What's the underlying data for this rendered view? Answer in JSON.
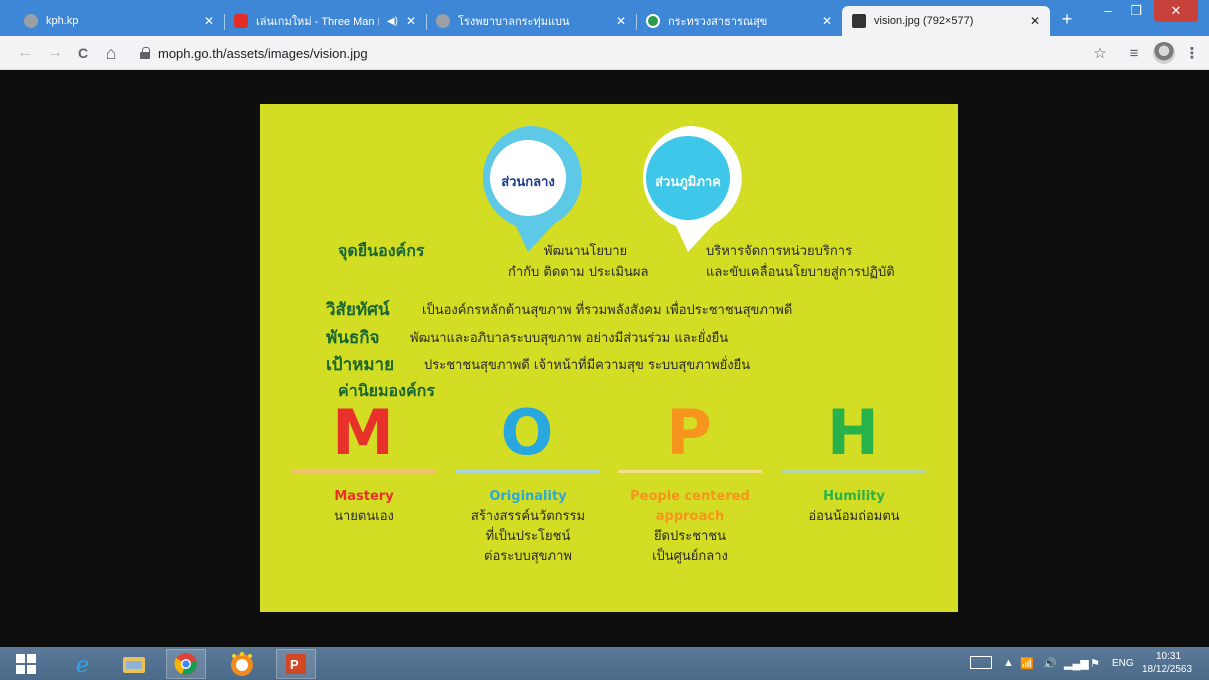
{
  "browser": {
    "tabs": [
      {
        "title": "kph.kp",
        "favicon_color": "#9aa0a6",
        "active": false
      },
      {
        "title": "เล่นเกมใหม่ - Three Man Down",
        "favicon_color": "#e52d27",
        "active": false,
        "audio_icon": "speaker-icon"
      },
      {
        "title": "โรงพยาบาลกระทุ่มแบน",
        "favicon_color": "#9aa0a6",
        "active": false
      },
      {
        "title": "กระทรวงสาธารณสุข",
        "favicon_color": "#2e9a4c",
        "active": false
      },
      {
        "title": "vision.jpg (792×577)",
        "favicon_color": "#333333",
        "active": true
      }
    ],
    "new_tab": "+",
    "window_controls": {
      "minimize": "–",
      "maximize": "❐",
      "close": "✕"
    },
    "url": "moph.go.th/assets/images/vision.jpg",
    "nav": {
      "back": "←",
      "forward": "→",
      "reload": "C",
      "home": "⌂"
    },
    "toolbar_icons": {
      "star": "☆",
      "playlist": "≡",
      "menu": "⋮"
    }
  },
  "slide": {
    "pins": [
      {
        "label": "ส่วนกลาง",
        "ring": "#5ec9e6",
        "fill": "#ffffff",
        "text_color": "#1a3a8a"
      },
      {
        "label": "ส่วนภูมิภาค",
        "ring": "#ffffff",
        "fill": "#3ec7e8",
        "text_color": "#ffffff"
      }
    ],
    "stance_heading": "จุดยืนองค์กร",
    "stance_central": [
      "พัฒนานโยบาย",
      "กำกับ ติดตาม ประเมินผล"
    ],
    "stance_regional": [
      "บริหารจัดการหน่วยบริการ",
      "และขับเคลื่อนนโยบายสู่การปฏิบัติ"
    ],
    "vision_heading": "วิสัยทัศน์",
    "vision_text": "เป็นองค์กรหลักด้านสุขภาพ ที่รวมพลังสังคม เพื่อประชาชนสุขภาพดี",
    "mission_heading": "พันธกิจ",
    "mission_text": "พัฒนาและอภิบาลระบบสุขภาพ อย่างมีส่วนร่วม และยั่งยืน",
    "goal_heading": "เป้าหมาย",
    "goal_text": "ประชาชนสุขภาพดี เจ้าหน้าที่มีความสุข ระบบสุขภาพยั่งยืน",
    "values_heading": "ค่านิยมองค์กร",
    "values": [
      {
        "letter": "M",
        "color": "#e8312a",
        "line": "#f5c07a",
        "name": [
          "Mastery"
        ],
        "desc": [
          "นายตนเอง"
        ]
      },
      {
        "letter": "O",
        "color": "#29a8e0",
        "line": "#a8d8d8",
        "name": [
          "Originality"
        ],
        "desc": [
          "สร้างสรรค์นวัตกรรม",
          "ที่เป็นประโยชน์",
          "ต่อระบบสุขภาพ"
        ]
      },
      {
        "letter": "P",
        "color": "#f7941d",
        "line": "#f3e08a",
        "name": [
          "People centered",
          "approach"
        ],
        "desc": [
          "ยึดประชาชน",
          "เป็นศูนย์กลาง"
        ]
      },
      {
        "letter": "H",
        "color": "#2ab24a",
        "line": "#b8d8a0",
        "name": [
          "Humility"
        ],
        "desc": [
          "อ่อนน้อมถ่อมตน"
        ]
      }
    ]
  },
  "taskbar": {
    "language": "ENG",
    "time": "10:31",
    "date": "18/12/2563"
  }
}
